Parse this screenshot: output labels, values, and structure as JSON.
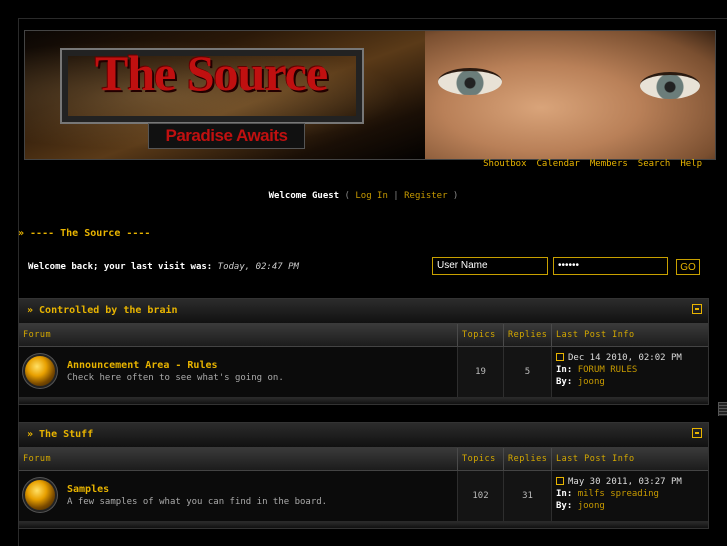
{
  "banner": {
    "title": "The Source",
    "subtitle": "Paradise Awaits"
  },
  "topnav": [
    "Shoutbox",
    "Calendar",
    "Members",
    "Search",
    "Help"
  ],
  "welcome": {
    "greeting": "Welcome Guest",
    "open": "(",
    "login": "Log In",
    "sep": "|",
    "register": "Register",
    "close": ")"
  },
  "section": {
    "arrow": "»",
    "title": "---- The Source ----"
  },
  "last_visit": {
    "label": "Welcome back; your last visit was:",
    "value": "Today, 02:47 PM"
  },
  "login_form": {
    "username_value": "User Name",
    "password_value": "••••••",
    "go_label": "GO"
  },
  "columns": {
    "forum": "Forum",
    "topics": "Topics",
    "replies": "Replies",
    "last_post": "Last Post Info"
  },
  "categories": [
    {
      "title": "» Controlled by the brain",
      "forums": [
        {
          "name": "Announcement Area - Rules",
          "desc": "Check here often to see what's going on.",
          "topics": "19",
          "replies": "5",
          "last_date": "Dec 14 2010, 02:02 PM",
          "in_label": "In:",
          "in_value": "FORUM RULES",
          "by_label": "By:",
          "by_value": "joong"
        }
      ]
    },
    {
      "title": "» The Stuff",
      "forums": [
        {
          "name": "Samples",
          "desc": "A few samples of what you can find in the board.",
          "topics": "102",
          "replies": "31",
          "last_date": "May 30 2011, 03:27 PM",
          "in_label": "In:",
          "in_value": "milfs spreading",
          "by_label": "By:",
          "by_value": "joong"
        }
      ]
    }
  ],
  "colors": {
    "accent": "#e8b400",
    "link": "#c79a00",
    "background": "#000000",
    "logo_red": "#c01010"
  }
}
